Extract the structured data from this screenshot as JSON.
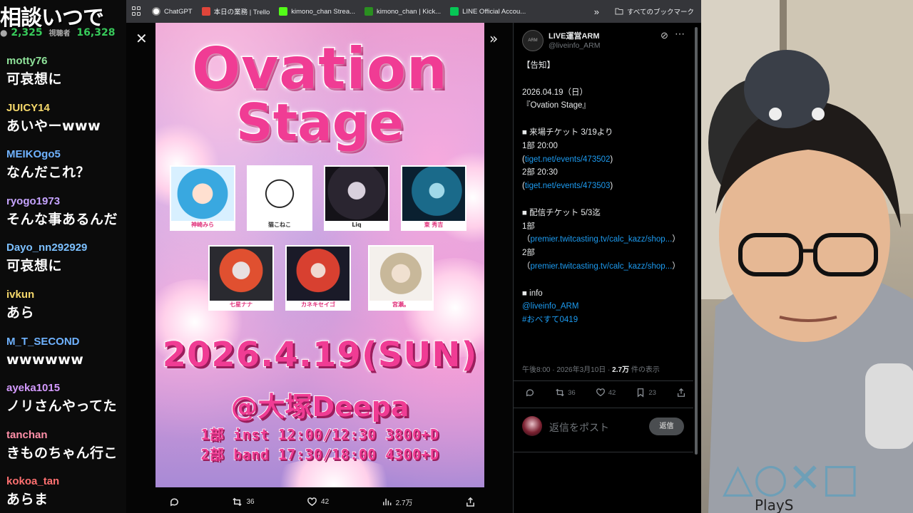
{
  "chat": {
    "banner": "相談いつで",
    "viewers": "2,325",
    "viewers_label": "視聴者",
    "likes": "16,328",
    "messages": [
      {
        "user": "motty76",
        "color": "#8fe39a",
        "text": "可哀想に"
      },
      {
        "user": "JUICY14",
        "color": "#f5d86b",
        "text": "あいやーwww"
      },
      {
        "user": "MEIKOgo5",
        "color": "#6fb2ff",
        "text": "なんだこれ？"
      },
      {
        "user": "ryogo1973",
        "color": "#c6a4ff",
        "text": "そんな事あるんだ"
      },
      {
        "user": "Dayo_nn292929",
        "color": "#7cc0ff",
        "text": "可哀想に"
      },
      {
        "user": "ivkun",
        "color": "#f5d86b",
        "text": "あら"
      },
      {
        "user": "M_T_SECOND",
        "color": "#6fb2ff",
        "text": "wwwwww"
      },
      {
        "user": "ayeka1015",
        "color": "#d49bff",
        "text": "ノリさんやってた"
      },
      {
        "user": "tanchan",
        "color": "#ff8fa8",
        "text": "きものちゃん行こ"
      },
      {
        "user": "kokoa_tan",
        "color": "#ff7070",
        "text": "あらま"
      }
    ]
  },
  "bookmarks": {
    "items": [
      {
        "label": "ChatGPT",
        "icon": "chatgpt-icon",
        "color": "#ffffff"
      },
      {
        "label": "本日の業務 | Trello",
        "icon": "trello-icon",
        "color": "#e0453a"
      },
      {
        "label": "kimono_chan Strea...",
        "icon": "kick-icon",
        "color": "#53fc18"
      },
      {
        "label": "kimono_chan | Kick...",
        "icon": "kick-dashboard-icon",
        "color": "#2a8f20"
      },
      {
        "label": "LINE Official Accou...",
        "icon": "line-icon",
        "color": "#06c755"
      }
    ],
    "more": "»",
    "all_bookmarks": "すべてのブックマーク"
  },
  "viewer": {
    "close": "✕",
    "next": "»",
    "poster": {
      "title_line1": "Ovation",
      "title_line2": "Stage",
      "artists": [
        {
          "name": "神崎みら"
        },
        {
          "name": "猫こねこ"
        },
        {
          "name": "Liq"
        },
        {
          "name": "東 秀吉"
        },
        {
          "name": "七星ナナ"
        },
        {
          "name": "カネキセイゴ"
        },
        {
          "name": "宮瀬。"
        }
      ],
      "date": "2026.4.19(SUN)",
      "venue": "@大塚Deepa",
      "schedule_1": "1部 inst 12:00/12:30 3800+D",
      "schedule_2": "2部 band 17:30/18:00 4300+D"
    },
    "actions": {
      "retweets": "36",
      "likes": "42",
      "views": "2.7万"
    }
  },
  "tweet": {
    "name": "LIVE運営ARM",
    "handle": "@liveinfo_ARM",
    "avatar_text": "ARM",
    "lines": {
      "l1": "【告知】",
      "l2": "2026.04.19（日）",
      "l3": "『Ovation Stage』",
      "l4": "■ 来場チケット 3/19より",
      "l5": "1部 20:00",
      "l6a": "(",
      "l6b": "tiget.net/events/473502",
      "l6c": ")",
      "l7": "2部 20:30",
      "l8a": "(",
      "l8b": "tiget.net/events/473503",
      "l8c": ")",
      "l9": "■ 配信チケット 5/3迄",
      "l10": "1部",
      "l11a": "（",
      "l11b": "premier.twitcasting.tv/calc_kazz/shop...",
      "l11c": "）",
      "l12": "2部",
      "l13a": "（",
      "l13b": "premier.twitcasting.tv/calc_kazz/shop...",
      "l13c": "）",
      "l14": "■ info",
      "l15": "@liveinfo_ARM",
      "l16": "#おべすて0419"
    },
    "meta_time": "午後8:00 · 2026年3月10日 · ",
    "meta_views": "2.7万",
    "meta_views_label": " 件の表示",
    "retweets": "36",
    "likes": "42",
    "bookmarks": "23",
    "reply_placeholder": "返信をポスト",
    "reply_button": "返信"
  }
}
